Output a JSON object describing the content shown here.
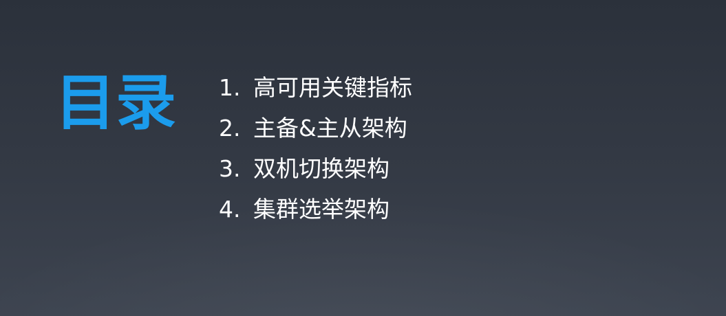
{
  "slide": {
    "title": "目录",
    "title_color": "#1b9cec",
    "items": [
      {
        "num": "1.",
        "text": "高可用关键指标"
      },
      {
        "num": "2.",
        "text": "主备&主从架构"
      },
      {
        "num": "3.",
        "text": "双机切换架构"
      },
      {
        "num": "4.",
        "text": "集群选举架构"
      }
    ]
  }
}
